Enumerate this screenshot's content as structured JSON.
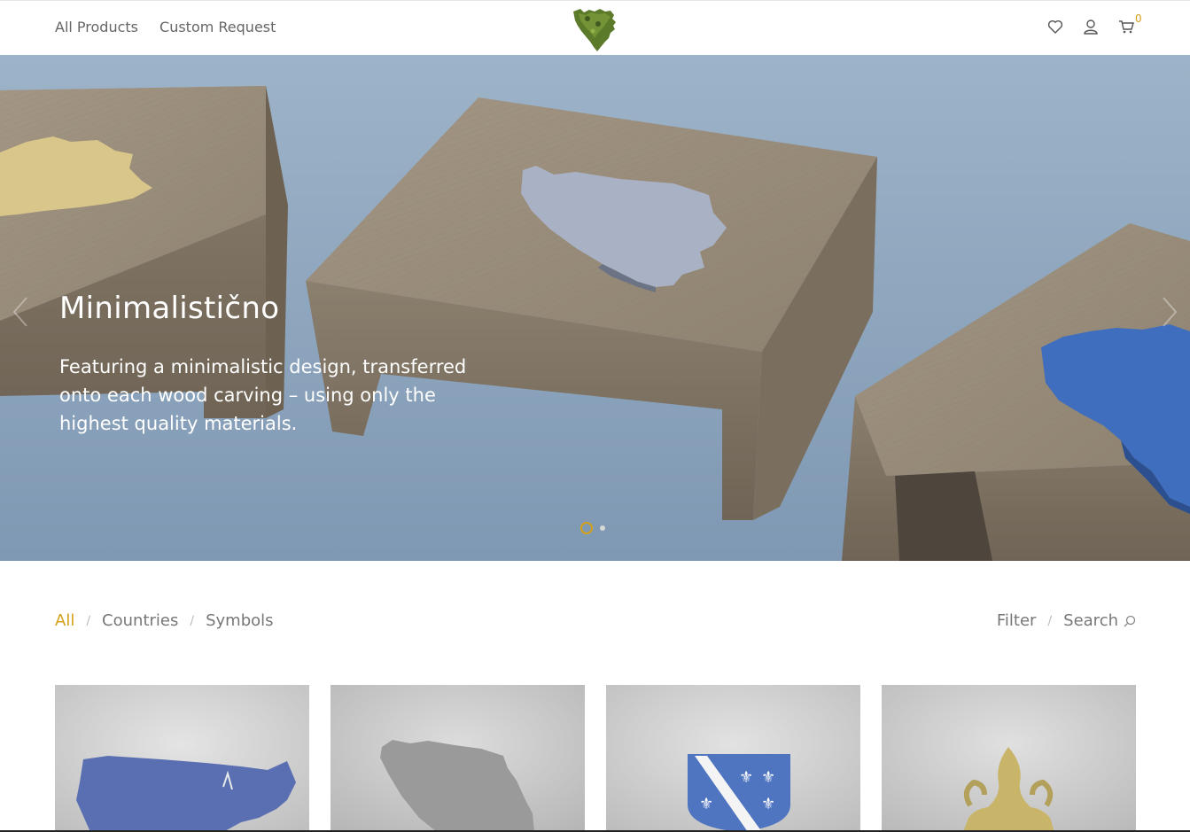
{
  "header": {
    "nav": [
      {
        "label": "All Products"
      },
      {
        "label": "Custom Request"
      }
    ],
    "logo_icon": "bosnia-map-logo",
    "icons": [
      "heart-icon",
      "user-icon",
      "cart-icon"
    ],
    "cart_count": "0"
  },
  "hero": {
    "title": "Minimalistično",
    "text": "Featuring a minimalistic design, transferred onto each wood carving – using only the highest quality materials.",
    "slides_total": 2,
    "active_slide": 1
  },
  "filters": {
    "categories": [
      {
        "label": "All"
      },
      {
        "label": "Countries"
      },
      {
        "label": "Symbols"
      }
    ],
    "active_category": "All",
    "tools": [
      {
        "label": "Filter"
      },
      {
        "label": "Search"
      }
    ]
  },
  "products": [
    {
      "name": "usa-map-product"
    },
    {
      "name": "bosnia-map-product"
    },
    {
      "name": "coat-of-arms-product"
    },
    {
      "name": "fleur-de-lis-product"
    }
  ],
  "colors": {
    "accent": "#d4a017",
    "nav_text": "#666666",
    "hero_bg": "#8fa6bf"
  }
}
